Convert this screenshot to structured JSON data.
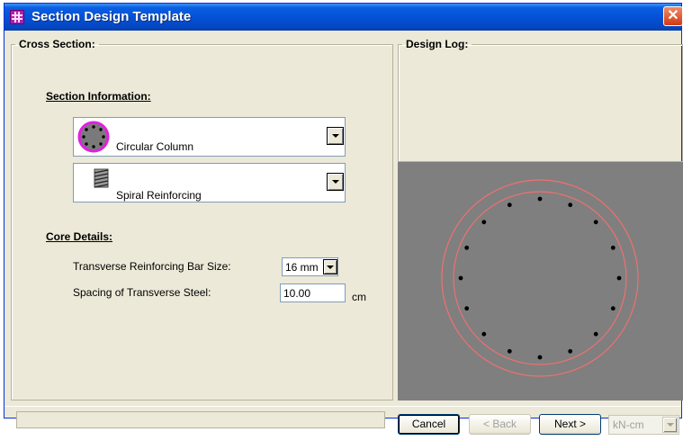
{
  "window": {
    "title": "Section Design Template",
    "close_symbol": "✕"
  },
  "cross_section": {
    "legend": "Cross Section:",
    "section_info_heading": "Section Information:",
    "section_type": {
      "selected": "Circular Column",
      "icon": "circular-column-icon"
    },
    "reinforcing_type": {
      "selected": "Spiral Reinforcing",
      "icon": "spiral-reinforcing-icon"
    },
    "core_details_heading": "Core Details:",
    "bar_size": {
      "label": "Transverse Reinforcing Bar Size:",
      "selected": "16 mm"
    },
    "spacing": {
      "label": "Spacing of Transverse Steel:",
      "value": "10.00",
      "unit": "cm"
    }
  },
  "design_log": {
    "legend": "Design Log:"
  },
  "preview": {
    "background": "#7f7f7f",
    "circle_color": "#f07070",
    "bar_color": "#000000",
    "bar_count": 16
  },
  "footer": {
    "cancel_label": "Cancel",
    "back_label": "< Back",
    "next_label": "Next >",
    "units_selected": "kN-cm"
  }
}
